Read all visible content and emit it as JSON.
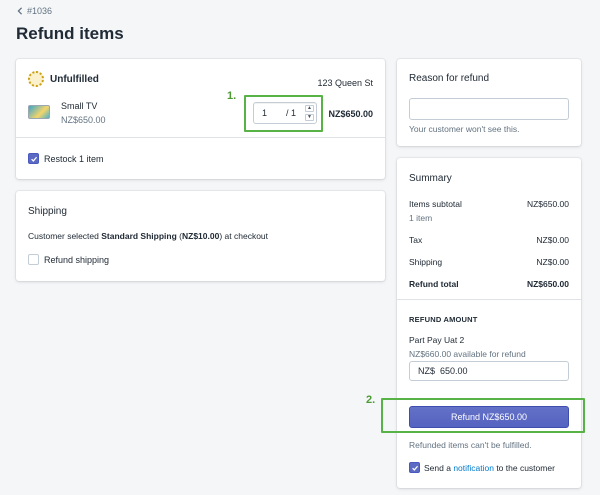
{
  "header": {
    "back_label": "#1036",
    "title": "Refund items"
  },
  "items_card": {
    "status": "Unfulfilled",
    "location": "123 Queen St",
    "item": {
      "name": "Small TV",
      "unit_price": "NZ$650.00",
      "quantity": "1",
      "max_quantity": "/ 1",
      "total": "NZ$650.00"
    },
    "restock_label": "Restock 1 item",
    "restock_checked": true
  },
  "shipping_card": {
    "title": "Shipping",
    "desc_prefix": "Customer selected ",
    "method": "Standard Shipping",
    "amount_open": " (",
    "amount": "NZ$10.00",
    "desc_suffix": ") at checkout",
    "refund_shipping_label": "Refund shipping"
  },
  "reason_card": {
    "title": "Reason for refund",
    "input_value": "",
    "hint": "Your customer won't see this."
  },
  "summary_card": {
    "title": "Summary",
    "items_subtotal_label": "Items subtotal",
    "items_subtotal_value": "NZ$650.00",
    "items_count": "1 item",
    "tax_label": "Tax",
    "tax_value": "NZ$0.00",
    "shipping_label": "Shipping",
    "shipping_value": "NZ$0.00",
    "refund_total_label": "Refund total",
    "refund_total_value": "NZ$650.00",
    "refund_amount_heading": "REFUND AMOUNT",
    "gateway": "Part Pay Uat 2",
    "available": "NZ$660.00 available for refund",
    "amount_input": "NZ$  650.00",
    "refund_button": "Refund NZ$650.00",
    "note": "Refunded items can't be fulfilled.",
    "send_prefix": "Send a ",
    "send_link": "notification",
    "send_suffix": " to the customer",
    "send_checked": true
  },
  "annotations": {
    "step1": "1.",
    "step2": "2."
  },
  "colors": {
    "accent": "#5c6ac4",
    "highlight": "#58b347",
    "link": "#007ace",
    "background": "#f4f6f8"
  }
}
